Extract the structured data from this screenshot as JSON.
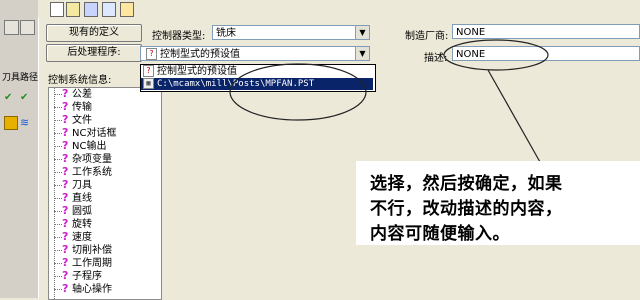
{
  "main": {
    "current_def_button": "现有的定义",
    "post_button": "后处理程序:",
    "controller_type_label": "控制器类型:",
    "controller_type_value": "铣床",
    "post_value": "控制型式的预设值",
    "manufacturer_label": "制造厂商:",
    "manufacturer_value": "NONE",
    "description_label": "描述:",
    "description_value": "NONE",
    "control_info_label": "控制系统信息:"
  },
  "left_strip": {
    "label": "刀具路径"
  },
  "dropdown": {
    "items": [
      {
        "label": "控制型式的预设值",
        "icon": "question-file-icon"
      },
      {
        "label": "C:\\mcamx\\mill\\Posts\\MPFAN.PST",
        "icon": "post-file-icon"
      }
    ]
  },
  "tree": {
    "items": [
      "公差",
      "传输",
      "文件",
      "NC对话框",
      "NC输出",
      "杂项变量",
      "工作系统",
      "刀具",
      "直线",
      "圆弧",
      "旋转",
      "速度",
      "切削补偿",
      "工作周期",
      "子程序",
      "轴心操作"
    ]
  },
  "annotation": {
    "line1": "选择，然后按确定，如果",
    "line2": "不行，改动描述的内容，",
    "line3": "内容可随便输入。"
  },
  "colors": {
    "selection": "#0a246a",
    "window_bg": "#ece9d8",
    "tree_icon": "#cc22cc"
  }
}
